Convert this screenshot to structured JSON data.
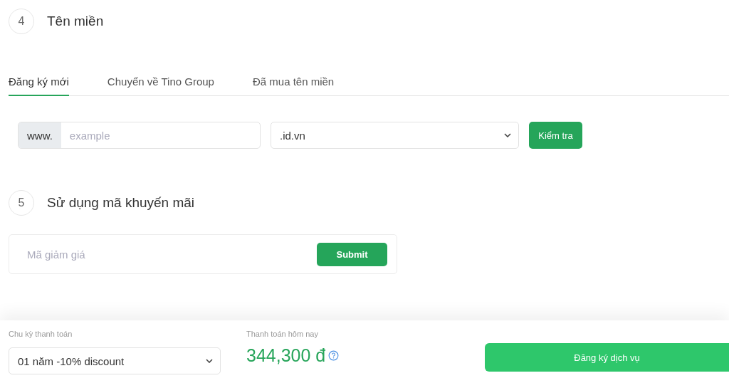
{
  "domain_section": {
    "step": "4",
    "title": "Tên miền",
    "tabs": [
      {
        "label": "Đăng ký mới",
        "selected": true
      },
      {
        "label": "Chuyển về Tino Group",
        "selected": false
      },
      {
        "label": "Đã mua tên miền",
        "selected": false
      }
    ],
    "prefix": "www.",
    "domain_field": {
      "placeholder": "example"
    },
    "extension": {
      "value": ".id.vn"
    },
    "check_button": "Kiểm tra"
  },
  "promo_section": {
    "step": "5",
    "title": "Sử dụng mã khuyến mãi",
    "code_field": {
      "placeholder": "Mã giảm giá"
    },
    "submit_button": "Submit"
  },
  "footer": {
    "cycle_label": "Chu kỳ thanh toán",
    "cycle": {
      "value": "01 năm -10% discount"
    },
    "today_label": "Thanh toán hôm nay",
    "total": "344,300 đ",
    "register_button": "Đăng ký dịch vụ"
  }
}
